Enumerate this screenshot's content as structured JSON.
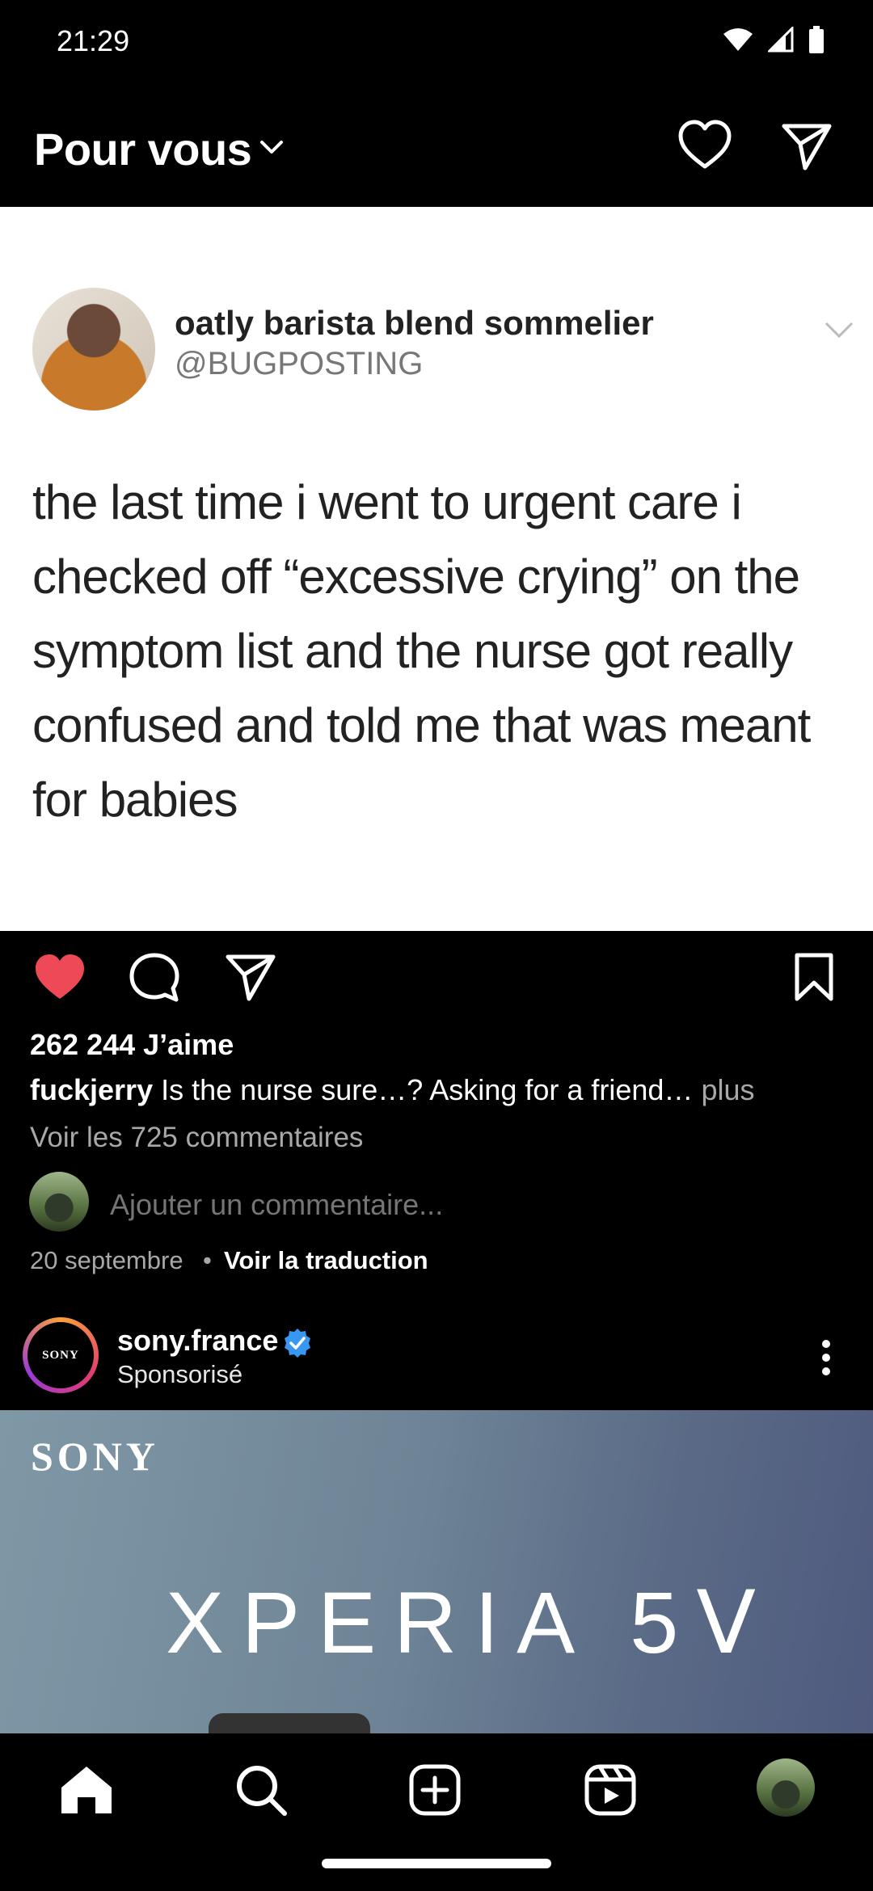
{
  "status_bar": {
    "time": "21:29",
    "icons": [
      "wifi-icon",
      "signal-icon",
      "battery-icon"
    ]
  },
  "header": {
    "title": "Pour vous"
  },
  "post": {
    "tweet": {
      "display_name": "oatly barista blend sommelier",
      "handle": "@BUGPOSTING",
      "text": "the last time i went to urgent care i checked off “excessive crying” on the symptom list and the nurse got really confused and told me that was meant for babies"
    },
    "likes": "262 244 J’aime",
    "caption_user": "fuckjerry",
    "caption_text": "Is the nurse sure…? Asking for a friend…",
    "caption_more": "plus",
    "view_comments": "Voir les 725 commentaires",
    "comment_placeholder": "Ajouter un commentaire...",
    "date": "20 septembre",
    "dot": "•",
    "translate": "Voir la traduction"
  },
  "sponsored": {
    "avatar_text": "SONY",
    "account": "sony.france",
    "label": "Sponsorisé",
    "brand": "SONY",
    "product": "XPERIA 5Ⅴ"
  },
  "colors": {
    "like": "#ed4956",
    "verified": "#3897f0"
  }
}
